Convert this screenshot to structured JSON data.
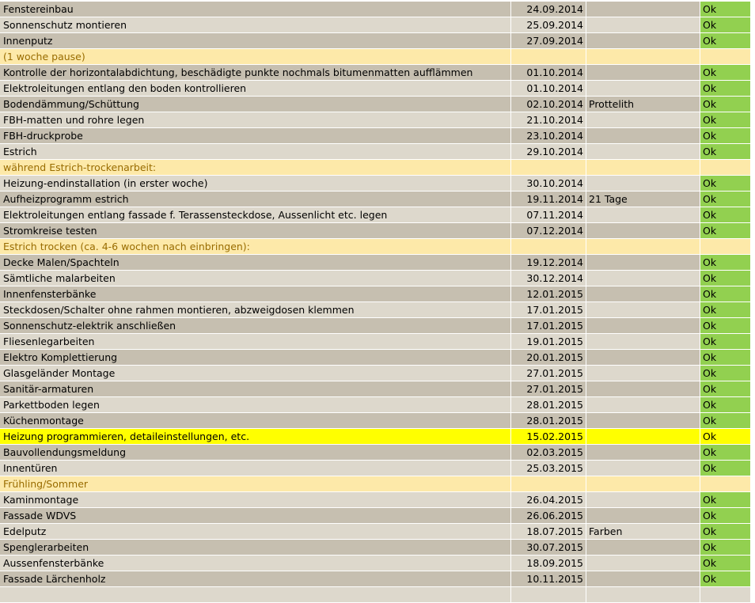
{
  "sheet": {
    "rows": [
      {
        "kind": "dark",
        "task": "Fenstereinbau",
        "date": "24.09.2014",
        "note": "",
        "status": "Ok"
      },
      {
        "kind": "light",
        "task": "Sonnenschutz montieren",
        "date": "25.09.2014",
        "note": "",
        "status": "Ok"
      },
      {
        "kind": "dark",
        "task": "Innenputz",
        "date": "27.09.2014",
        "note": "",
        "status": "Ok"
      },
      {
        "kind": "section",
        "task": "(1 woche pause)",
        "date": "",
        "note": "",
        "status": ""
      },
      {
        "kind": "dark",
        "task": "Kontrolle der horizontalabdichtung, beschädigte punkte nochmals bitumenmatten aufflämmen",
        "date": "01.10.2014",
        "note": "",
        "status": "Ok"
      },
      {
        "kind": "light",
        "task": "Elektroleitungen entlang den boden kontrollieren",
        "date": "01.10.2014",
        "note": "",
        "status": "Ok"
      },
      {
        "kind": "dark",
        "task": "Bodendämmung/Schüttung",
        "date": "02.10.2014",
        "note": "Prottelith",
        "status": "Ok"
      },
      {
        "kind": "light",
        "task": "FBH-matten und rohre legen",
        "date": "21.10.2014",
        "note": "",
        "status": "Ok"
      },
      {
        "kind": "dark",
        "task": "FBH-druckprobe",
        "date": "23.10.2014",
        "note": "",
        "status": "Ok"
      },
      {
        "kind": "light",
        "task": "Estrich",
        "date": "29.10.2014",
        "note": "",
        "status": "Ok"
      },
      {
        "kind": "section",
        "task": "während Estrich-trockenarbeit:",
        "date": "",
        "note": "",
        "status": ""
      },
      {
        "kind": "light",
        "task": "Heizung-endinstallation (in erster woche)",
        "date": "30.10.2014",
        "note": "",
        "status": "Ok"
      },
      {
        "kind": "dark",
        "task": "Aufheizprogramm estrich",
        "date": "19.11.2014",
        "note": "21 Tage",
        "status": "Ok"
      },
      {
        "kind": "light",
        "task": "Elektroleitungen entlang fassade f. Terassensteckdose, Aussenlicht etc. legen",
        "date": "07.11.2014",
        "note": "",
        "status": "Ok"
      },
      {
        "kind": "dark",
        "task": "Stromkreise testen",
        "date": "07.12.2014",
        "note": "",
        "status": "Ok"
      },
      {
        "kind": "section",
        "task": "Estrich trocken (ca. 4-6 wochen nach einbringen):",
        "date": "",
        "note": "",
        "status": ""
      },
      {
        "kind": "dark",
        "task": "Decke Malen/Spachteln",
        "date": "19.12.2014",
        "note": "",
        "status": "Ok"
      },
      {
        "kind": "light",
        "task": "Sämtliche malarbeiten",
        "date": "30.12.2014",
        "note": "",
        "status": "Ok"
      },
      {
        "kind": "dark",
        "task": "Innenfensterbänke",
        "date": "12.01.2015",
        "note": "",
        "status": "Ok"
      },
      {
        "kind": "light",
        "task": "Steckdosen/Schalter ohne rahmen montieren, abzweigdosen klemmen",
        "date": "17.01.2015",
        "note": "",
        "status": "Ok"
      },
      {
        "kind": "dark",
        "task": "Sonnenschutz-elektrik anschließen",
        "date": "17.01.2015",
        "note": "",
        "status": "Ok"
      },
      {
        "kind": "light",
        "task": "Fliesenlegarbeiten",
        "date": "19.01.2015",
        "note": "",
        "status": "Ok"
      },
      {
        "kind": "dark",
        "task": "Elektro Komplettierung",
        "date": "20.01.2015",
        "note": "",
        "status": "Ok"
      },
      {
        "kind": "light",
        "task": "Glasgeländer Montage",
        "date": "27.01.2015",
        "note": "",
        "status": "Ok"
      },
      {
        "kind": "dark",
        "task": "Sanitär-armaturen",
        "date": "27.01.2015",
        "note": "",
        "status": "Ok"
      },
      {
        "kind": "light",
        "task": "Parkettboden legen",
        "date": "28.01.2015",
        "note": "",
        "status": "Ok"
      },
      {
        "kind": "dark",
        "task": "Küchenmontage",
        "date": "28.01.2015",
        "note": "",
        "status": "Ok"
      },
      {
        "kind": "highlight",
        "task": "Heizung programmieren, detaileinstellungen, etc.",
        "date": "15.02.2015",
        "note": "",
        "status": "Ok"
      },
      {
        "kind": "dark",
        "task": "Bauvollendungsmeldung",
        "date": "02.03.2015",
        "note": "",
        "status": "Ok"
      },
      {
        "kind": "light",
        "task": "Innentüren",
        "date": "25.03.2015",
        "note": "",
        "status": "Ok"
      },
      {
        "kind": "section",
        "task": "Frühling/Sommer",
        "date": "",
        "note": "",
        "status": ""
      },
      {
        "kind": "light",
        "task": "Kaminmontage",
        "date": "26.04.2015",
        "note": "",
        "status": "Ok"
      },
      {
        "kind": "dark",
        "task": "Fassade WDVS",
        "date": "26.06.2015",
        "note": "",
        "status": "Ok"
      },
      {
        "kind": "light",
        "task": "Edelputz",
        "date": "18.07.2015",
        "note": "Farben",
        "status": "Ok",
        "comment": true
      },
      {
        "kind": "dark",
        "task": "Spenglerarbeiten",
        "date": "30.07.2015",
        "note": "",
        "status": "Ok"
      },
      {
        "kind": "light",
        "task": "Aussenfensterbänke",
        "date": "18.09.2015",
        "note": "",
        "status": "Ok"
      },
      {
        "kind": "dark",
        "task": "Fassade Lärchenholz",
        "date": "10.11.2015",
        "note": "",
        "status": "Ok"
      },
      {
        "kind": "light",
        "task": "",
        "date": "",
        "note": "",
        "status": ""
      }
    ],
    "colors": {
      "row_dark": "#c6bfb0",
      "row_light": "#ddd8cc",
      "section_fill": "#fde9a9",
      "section_text": "#996c00",
      "highlight": "#ffff00",
      "status_ok": "#92d050",
      "comment_marker": "#e00000"
    }
  }
}
